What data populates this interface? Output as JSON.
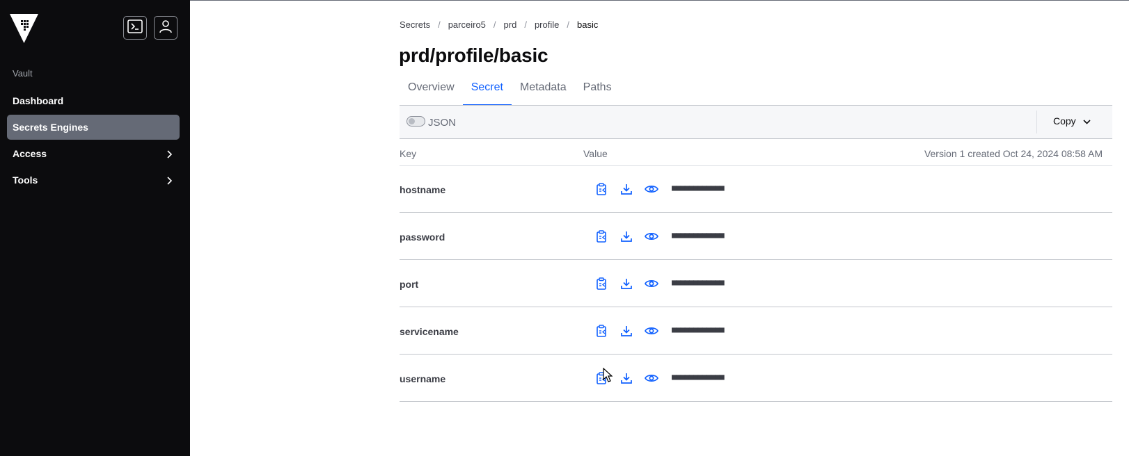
{
  "sidebar": {
    "section_label": "Vault",
    "items": [
      {
        "label": "Dashboard",
        "active": false,
        "has_submenu": false
      },
      {
        "label": "Secrets Engines",
        "active": true,
        "has_submenu": false
      },
      {
        "label": "Access",
        "active": false,
        "has_submenu": true
      },
      {
        "label": "Tools",
        "active": false,
        "has_submenu": true
      }
    ]
  },
  "breadcrumb": [
    "Secrets",
    "parceiro5",
    "prd",
    "profile",
    "basic"
  ],
  "breadcrumb_separator": "/",
  "page_title": "prd/profile/basic",
  "tabs": [
    {
      "label": "Overview",
      "active": false
    },
    {
      "label": "Secret",
      "active": true
    },
    {
      "label": "Metadata",
      "active": false
    },
    {
      "label": "Paths",
      "active": false
    }
  ],
  "toolbar": {
    "json_toggle_label": "JSON",
    "json_toggle_on": false,
    "copy_label": "Copy"
  },
  "table": {
    "col_key": "Key",
    "col_value": "Value",
    "version_info": "Version 1 created Oct 24, 2024 08:58 AM",
    "rows": [
      {
        "key": "hostname",
        "value_masked": "■■■■■■■■■■■■"
      },
      {
        "key": "password",
        "value_masked": "■■■■■■■■■■■■"
      },
      {
        "key": "port",
        "value_masked": "■■■■■■■■■■■■"
      },
      {
        "key": "servicename",
        "value_masked": "■■■■■■■■■■■■"
      },
      {
        "key": "username",
        "value_masked": "■■■■■■■■■■■■"
      }
    ]
  },
  "icons": {
    "logo": "vault-logo-icon",
    "console": "terminal-icon",
    "user": "user-icon",
    "row_actions": [
      "copy-icon",
      "download-icon",
      "eye-icon"
    ]
  },
  "colors": {
    "sidebar_bg": "#0c0c0e",
    "active_nav_bg": "#656a76",
    "accent": "#1060ff"
  }
}
